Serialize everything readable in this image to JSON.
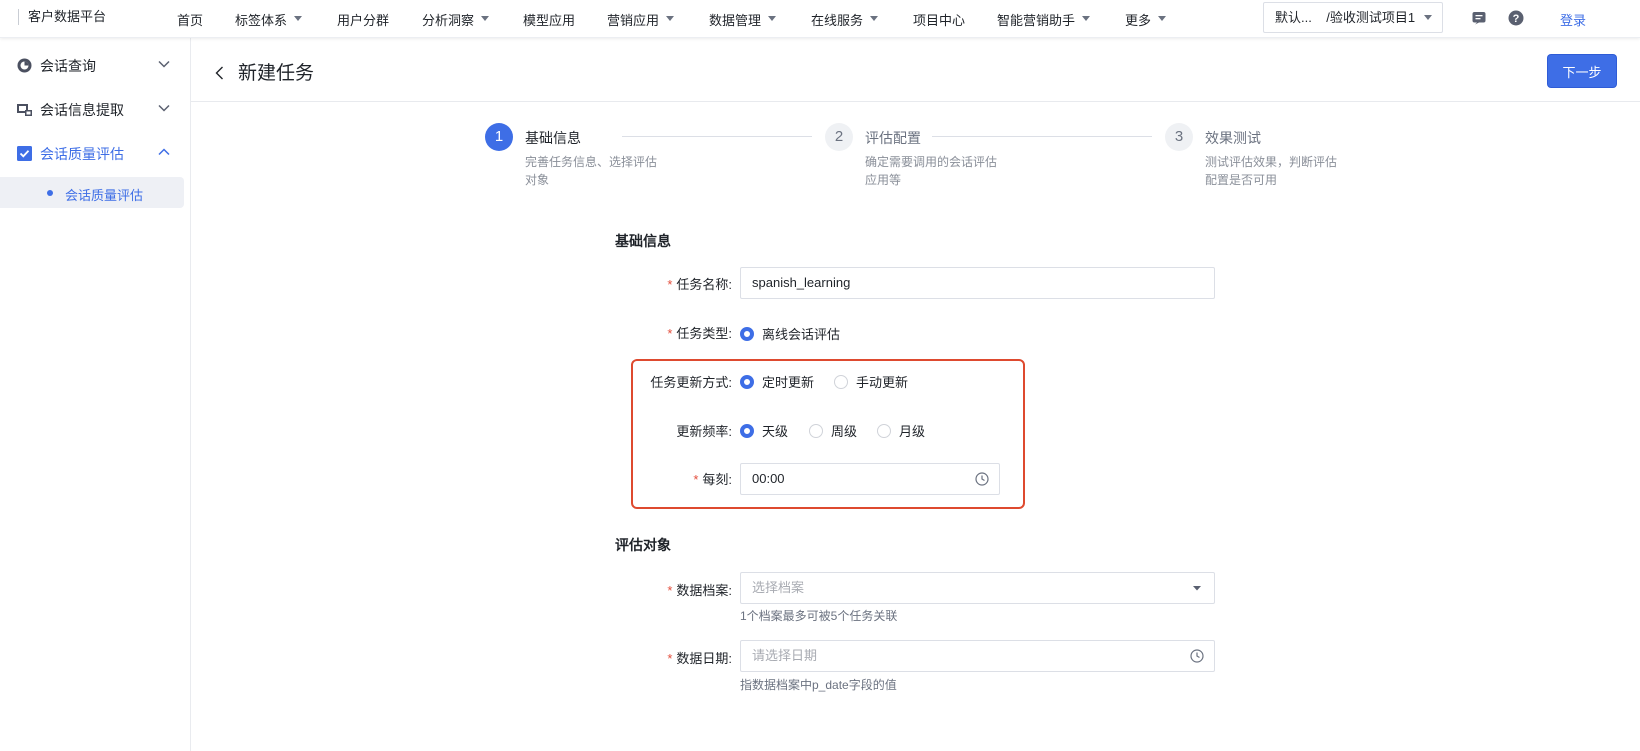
{
  "topnav": {
    "brand": "客户数据平台",
    "items": [
      {
        "label": "首页",
        "caret": false
      },
      {
        "label": "标签体系",
        "caret": true
      },
      {
        "label": "用户分群",
        "caret": false
      },
      {
        "label": "分析洞察",
        "caret": true
      },
      {
        "label": "模型应用",
        "caret": false
      },
      {
        "label": "营销应用",
        "caret": true
      },
      {
        "label": "数据管理",
        "caret": true
      },
      {
        "label": "在线服务",
        "caret": true
      },
      {
        "label": "项目中心",
        "caret": false
      },
      {
        "label": "智能营销助手",
        "caret": true
      },
      {
        "label": "更多",
        "caret": true
      }
    ],
    "project_selector": "默认...    /验收测试项目1",
    "login": "登录"
  },
  "sidebar": {
    "items": [
      {
        "label": "会话查询",
        "icon": "headset-icon",
        "expanded": false
      },
      {
        "label": "会话信息提取",
        "icon": "extract-icon",
        "expanded": false
      },
      {
        "label": "会话质量评估",
        "icon": "checkbox-icon",
        "expanded": true
      }
    ],
    "sub_items": [
      {
        "label": "会话质量评估",
        "active": true
      }
    ]
  },
  "header": {
    "title": "新建任务",
    "next_button": "下一步"
  },
  "steps": [
    {
      "number": "1",
      "title": "基础信息",
      "desc": "完善任务信息、选择评估对象",
      "active": true
    },
    {
      "number": "2",
      "title": "评估配置",
      "desc": "确定需要调用的会话评估应用等",
      "active": false
    },
    {
      "number": "3",
      "title": "效果测试",
      "desc": "测试评估效果，判断评估配置是否可用",
      "active": false
    }
  ],
  "form": {
    "basic_section": "基础信息",
    "task_name_label": "任务名称:",
    "task_name_value": "spanish_learning",
    "task_type_label": "任务类型:",
    "task_type_option": "离线会话评估",
    "update_mode_label": "任务更新方式:",
    "update_mode_options": [
      "定时更新",
      "手动更新"
    ],
    "update_mode_selected": "定时更新",
    "frequency_label": "更新频率:",
    "frequency_options": [
      "天级",
      "周级",
      "月级"
    ],
    "frequency_selected": "天级",
    "time_label": "每刻:",
    "time_value": "00:00",
    "target_section": "评估对象",
    "archive_label": "数据档案:",
    "archive_placeholder": "选择档案",
    "archive_help": "1个档案最多可被5个任务关联",
    "date_label": "数据日期:",
    "date_placeholder": "请选择日期",
    "date_help": "指数据档案中p_date字段的值"
  },
  "colors": {
    "primary": "#3e6ee6",
    "required": "#e34d3c",
    "highlight_border": "#de4a2f"
  }
}
